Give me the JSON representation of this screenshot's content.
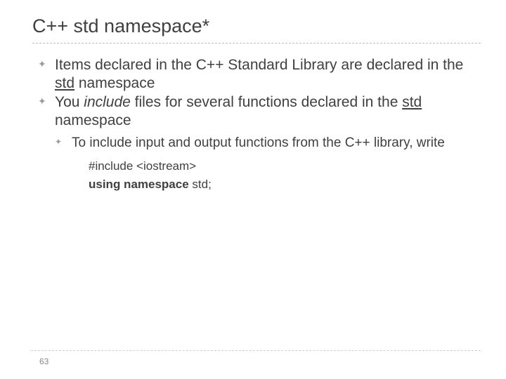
{
  "title": "C++ std namespace*",
  "bullets": {
    "b1_pre": "Items declared in the C++ Standard Library are declared in the ",
    "b1_u": "std",
    "b1_post": " namespace",
    "b2_pre": "You ",
    "b2_it": "include",
    "b2_mid": " files for several functions declared in the ",
    "b2_u": "std",
    "b2_post": " namespace",
    "sub1": "To include input and output functions from the C++ library, write",
    "code1": "#include <iostream>",
    "code2_b": "using namespace",
    "code2_r": " std;"
  },
  "page": "63"
}
